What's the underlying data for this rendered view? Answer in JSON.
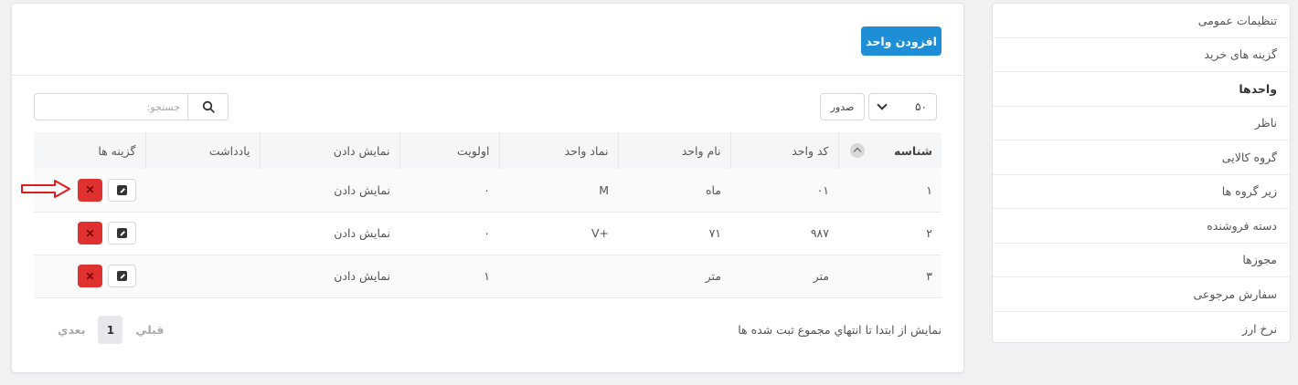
{
  "sidebar": {
    "items": [
      {
        "label": "تنظیمات عمومی"
      },
      {
        "label": "گزینه های خرید"
      },
      {
        "label": "واحدها"
      },
      {
        "label": "ناظر"
      },
      {
        "label": "گروه کالایی"
      },
      {
        "label": "زیر گروه ها"
      },
      {
        "label": "دسته فروشنده"
      },
      {
        "label": "مجوزها"
      },
      {
        "label": "سفارش مرجوعی"
      },
      {
        "label": "نرخ ارز"
      }
    ]
  },
  "header": {
    "add_button": "افزودن واحد"
  },
  "toolbar": {
    "page_size": "۵۰",
    "export_label": "صدور",
    "search_placeholder": "جستجو:"
  },
  "table": {
    "columns": [
      "شناسه",
      "کد واحد",
      "نام واحد",
      "نماد واحد",
      "اولویت",
      "نمایش دادن",
      "یادداشت",
      "گزینه ها"
    ],
    "rows": [
      {
        "id": "۱",
        "code": "۰۱",
        "name": "ماه",
        "symbol": "M",
        "priority": "۰",
        "display": "نمایش دادن",
        "note": ""
      },
      {
        "id": "۲",
        "code": "۹۸۷",
        "name": "۷۱",
        "symbol": "+V",
        "priority": "۰",
        "display": "نمایش دادن",
        "note": ""
      },
      {
        "id": "۳",
        "code": "متر",
        "name": "متر",
        "symbol": "",
        "priority": "۱",
        "display": "نمایش دادن",
        "note": ""
      }
    ]
  },
  "footer": {
    "info": "نمایش از ابتدا تا انتهاي مجموع ثبت شده ها",
    "prev_label": "قبلي",
    "next_label": "بعدي",
    "current_page": "1"
  },
  "colors": {
    "accent": "#1e8ed6",
    "delete": "#e03131",
    "annotation_arrow": "#e01b1b"
  }
}
